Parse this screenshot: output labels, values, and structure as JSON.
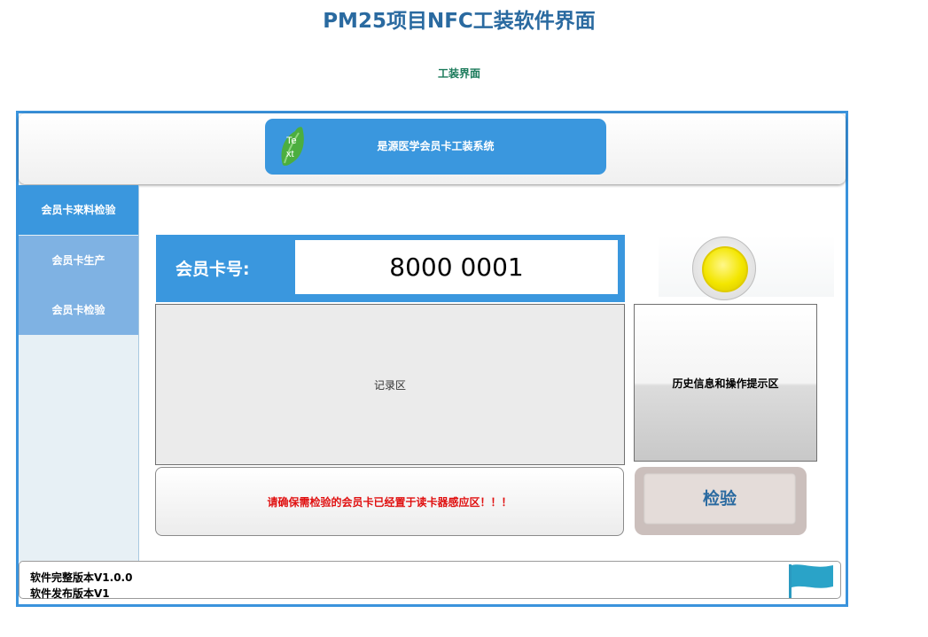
{
  "page": {
    "title": "PM25项目NFC工装软件界面",
    "subtitle": "工装界面"
  },
  "header": {
    "system_name": "是源医学会员卡工装系统",
    "logo_text": "Te xt",
    "logo_text_line1": "Te",
    "logo_text_line2": "xt"
  },
  "sidebar": {
    "items": [
      {
        "label": "会员卡来料检验",
        "active": true
      },
      {
        "label": "会员卡生产",
        "active": false
      },
      {
        "label": "会员卡检验",
        "active": false
      }
    ]
  },
  "card": {
    "label": "会员卡号:",
    "number": "8000 0001"
  },
  "status_indicator": {
    "color": "#f3e600"
  },
  "record_area": {
    "label": "记录区"
  },
  "history_area": {
    "label": "历史信息和操作提示区"
  },
  "notice": {
    "text": "请确保需检验的会员卡已经置于读卡器感应区！！！"
  },
  "inspect_button": {
    "label": "检验"
  },
  "footer": {
    "version_full": "软件完整版本V1.0.0",
    "version_release": "软件发布版本V1"
  },
  "colors": {
    "accent": "#3a97de",
    "frame": "#3a93dc",
    "title": "#2a6aa0",
    "notice": "#e01010"
  }
}
